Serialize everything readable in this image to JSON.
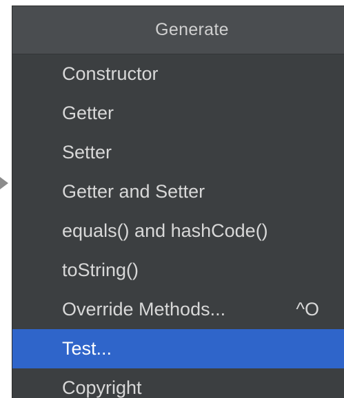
{
  "popup": {
    "title": "Generate",
    "items": [
      {
        "label": "Constructor",
        "shortcut": ""
      },
      {
        "label": "Getter",
        "shortcut": ""
      },
      {
        "label": "Setter",
        "shortcut": ""
      },
      {
        "label": "Getter and Setter",
        "shortcut": ""
      },
      {
        "label": "equals() and hashCode()",
        "shortcut": ""
      },
      {
        "label": "toString()",
        "shortcut": ""
      },
      {
        "label": "Override Methods...",
        "shortcut": "^O"
      },
      {
        "label": "Test...",
        "shortcut": ""
      },
      {
        "label": "Copyright",
        "shortcut": ""
      }
    ],
    "selected_label": "Test..."
  },
  "colors": {
    "popup_background": "#3c3f41",
    "header_background": "#4a4d50",
    "selection": "#2f65ca",
    "text": "#d8d8d8"
  }
}
